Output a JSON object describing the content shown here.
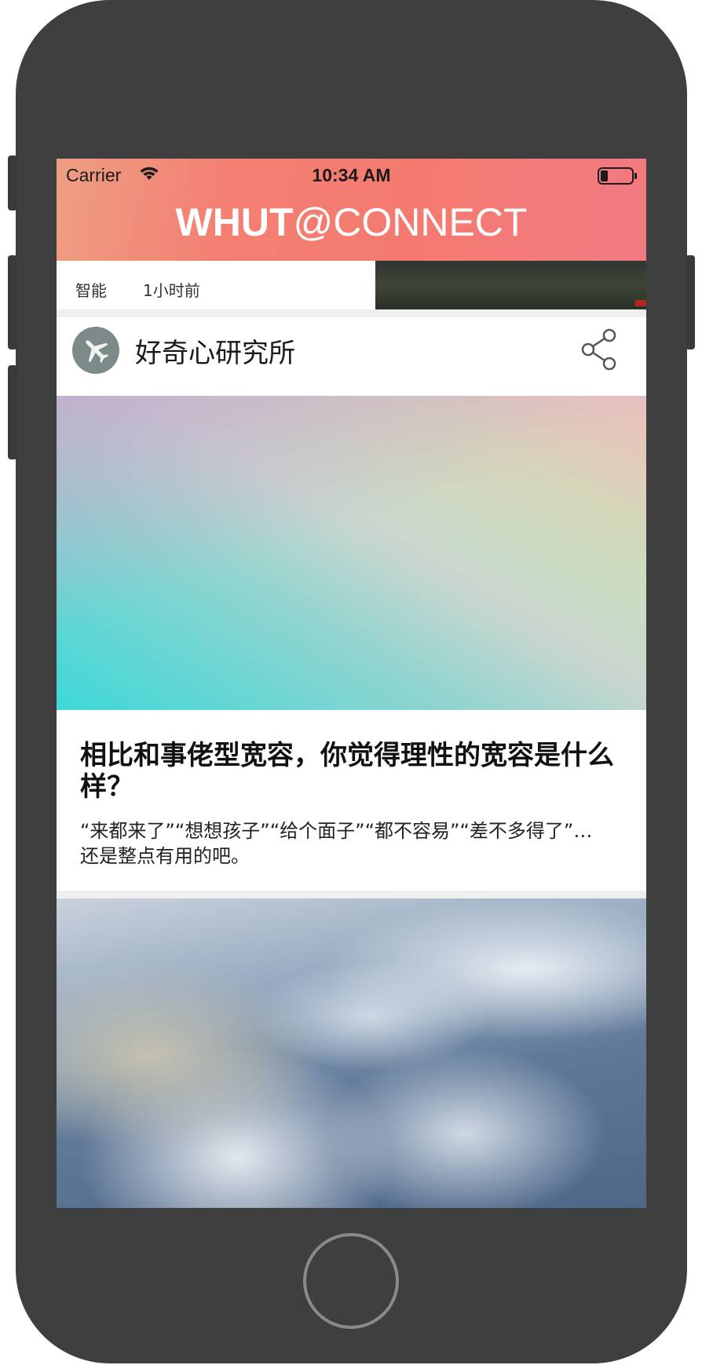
{
  "status_bar": {
    "carrier": "Carrier",
    "time": "10:34 AM",
    "icons": [
      "wifi-icon",
      "battery-icon"
    ]
  },
  "header": {
    "title_bold": "WHUT",
    "title_light": "@CONNECT",
    "gradient_colors": [
      "#ee9e83",
      "#f47f72",
      "#f27a82"
    ]
  },
  "previous_card": {
    "tag": "智能",
    "time_ago": "1小时前"
  },
  "card": {
    "author": "好奇心研究所",
    "avatar_icon": "airplane-icon",
    "share_icon": "share-icon",
    "title": "相比和事佬型宽容，你觉得理性的宽容是什么样？",
    "description": "“来都来了”“想想孩子”“给个面子”“都不容易”“差不多得了”…还是整点有用的吧。"
  },
  "colors": {
    "phone_frame": "#3f3f3f",
    "screen_bg": "#efefef",
    "card_bg": "#ffffff",
    "title_text": "#ffffff"
  }
}
